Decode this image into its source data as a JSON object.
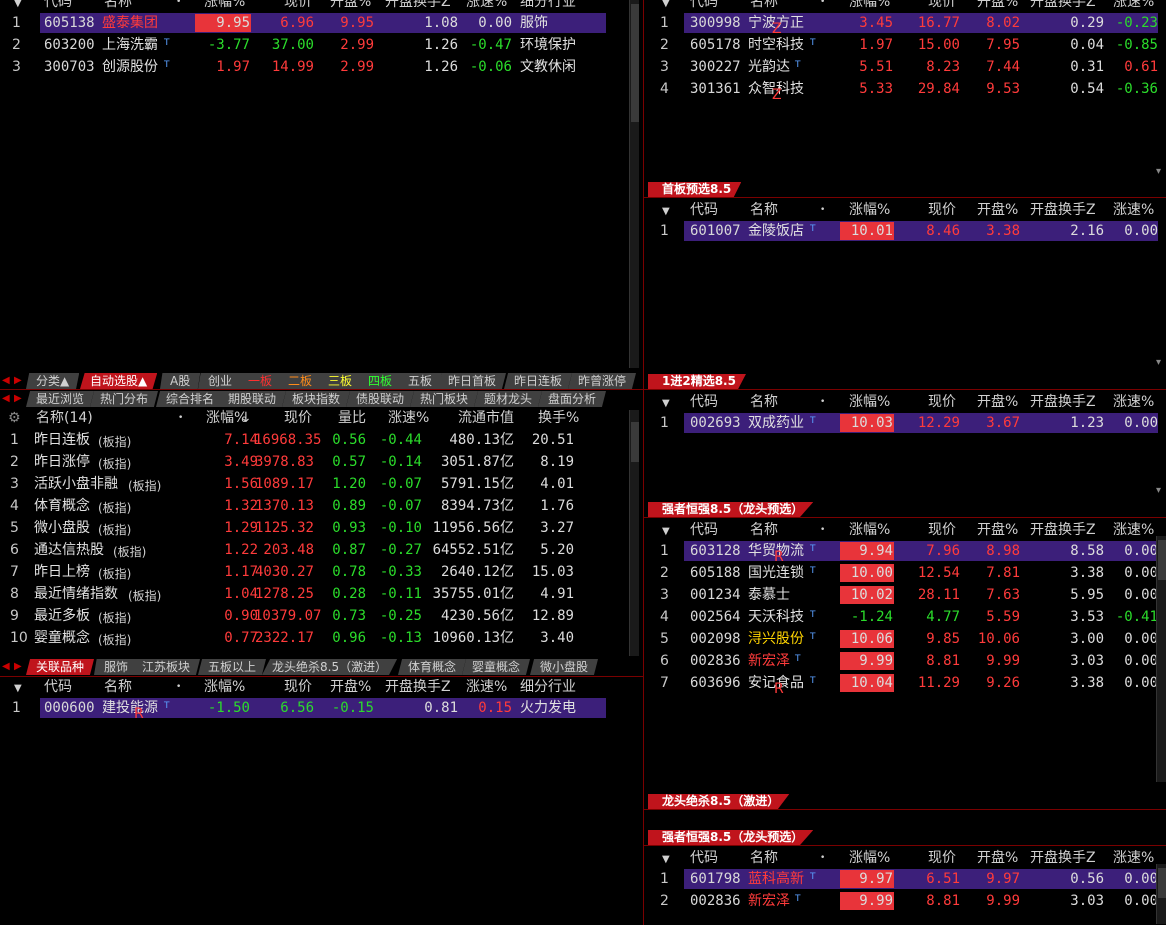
{
  "colors": {
    "up": "#ff3b3b",
    "down": "#2bdc2b",
    "selected": "#3c1f7a",
    "accent": "#c0141c"
  },
  "top_left": {
    "header": [
      "代码",
      "名称",
      "•",
      "涨幅%",
      "现价",
      "开盘%",
      "开盘换手Z",
      "涨速%",
      "细分行业"
    ],
    "rows": [
      {
        "idx": "1",
        "code": "605138",
        "name": "盛泰集团",
        "chg": "9.95",
        "price": "6.96",
        "open": "9.95",
        "turn": "1.08",
        "speed": "0.00",
        "industry": "服饰"
      },
      {
        "idx": "2",
        "code": "603200",
        "name": "上海洗霸",
        "chg": "-3.77",
        "price": "37.00",
        "open": "2.99",
        "turn": "1.26",
        "speed": "-0.47",
        "industry": "环境保护"
      },
      {
        "idx": "3",
        "code": "300703",
        "name": "创源股份",
        "chg": "1.97",
        "price": "14.99",
        "open": "2.99",
        "turn": "1.26",
        "speed": "-0.06",
        "industry": "文教休闲"
      }
    ]
  },
  "tabs1": [
    "分类▲",
    "自动选股▲",
    "A股",
    "创业",
    "一板",
    "二板",
    "三板",
    "四板",
    "五板",
    "昨日首板",
    "昨日连板",
    "昨曾涨停"
  ],
  "tabs2": [
    "最近浏览",
    "热门分布",
    "综合排名",
    "期股联动",
    "板块指数",
    "债股联动",
    "热门板块",
    "题材龙头",
    "盘面分析"
  ],
  "sector": {
    "header": [
      "名称(14)",
      "•",
      "涨幅%",
      "现价",
      "量比",
      "涨速%",
      "流通市值",
      "换手%"
    ],
    "suffix": "(板指)",
    "rows": [
      {
        "idx": "1",
        "name": "昨日连板",
        "chg": "7.14",
        "price": "16968.35",
        "vr": "0.56",
        "speed": "-0.44",
        "cap": "480.13亿",
        "turn": "20.51"
      },
      {
        "idx": "2",
        "name": "昨日涨停",
        "chg": "3.49",
        "price": "3978.83",
        "vr": "0.57",
        "speed": "-0.14",
        "cap": "3051.87亿",
        "turn": "8.19"
      },
      {
        "idx": "3",
        "name": "活跃小盘非融",
        "chg": "1.56",
        "price": "1089.17",
        "vr": "1.20",
        "speed": "-0.07",
        "cap": "5791.15亿",
        "turn": "4.01"
      },
      {
        "idx": "4",
        "name": "体育概念",
        "chg": "1.32",
        "price": "1370.13",
        "vr": "0.89",
        "speed": "-0.07",
        "cap": "8394.73亿",
        "turn": "1.76"
      },
      {
        "idx": "5",
        "name": "微小盘股",
        "chg": "1.29",
        "price": "1125.32",
        "vr": "0.93",
        "speed": "-0.10",
        "cap": "11956.56亿",
        "turn": "3.27"
      },
      {
        "idx": "6",
        "name": "通达信热股",
        "chg": "1.22",
        "price": "203.48",
        "vr": "0.87",
        "speed": "-0.27",
        "cap": "64552.51亿",
        "turn": "5.20"
      },
      {
        "idx": "7",
        "name": "昨日上榜",
        "chg": "1.17",
        "price": "4030.27",
        "vr": "0.78",
        "speed": "-0.33",
        "cap": "2640.12亿",
        "turn": "15.03"
      },
      {
        "idx": "8",
        "name": "最近情绪指数",
        "chg": "1.04",
        "price": "1278.25",
        "vr": "0.28",
        "speed": "-0.11",
        "cap": "35755.01亿",
        "turn": "4.91"
      },
      {
        "idx": "9",
        "name": "最近多板",
        "chg": "0.90",
        "price": "10379.07",
        "vr": "0.73",
        "speed": "-0.25",
        "cap": "4230.56亿",
        "turn": "12.89"
      },
      {
        "idx": "10",
        "name": "婴童概念",
        "chg": "0.77",
        "price": "2322.17",
        "vr": "0.96",
        "speed": "-0.13",
        "cap": "10960.13亿",
        "turn": "3.40"
      }
    ]
  },
  "tabs3": [
    "关联品种",
    "服饰",
    "江苏板块",
    "五板以上",
    "龙头绝杀8.5（激进）",
    "体育概念",
    "婴童概念",
    "微小盘股"
  ],
  "related": {
    "header": [
      "代码",
      "名称",
      "•",
      "涨幅%",
      "现价",
      "开盘%",
      "开盘换手Z",
      "涨速%",
      "细分行业"
    ],
    "rows": [
      {
        "idx": "1",
        "code": "000600",
        "name": "建投能源",
        "tag": "R",
        "chg": "-1.50",
        "price": "6.56",
        "open": "-0.15",
        "turn": "0.81",
        "speed": "0.15",
        "industry": "火力发电"
      }
    ]
  },
  "right_header": [
    "代码",
    "名称",
    "•",
    "涨幅%",
    "现价",
    "开盘%",
    "开盘换手Z",
    "涨速%"
  ],
  "r1": {
    "rows": [
      {
        "idx": "1",
        "code": "300998",
        "name": "宁波方正",
        "tag": "Z",
        "chg": "3.45",
        "price": "16.77",
        "open": "8.02",
        "turn": "0.29",
        "speed": "-0.23"
      },
      {
        "idx": "2",
        "code": "605178",
        "name": "时空科技",
        "tag": "",
        "chg": "1.97",
        "price": "15.00",
        "open": "7.95",
        "turn": "0.04",
        "speed": "-0.85"
      },
      {
        "idx": "3",
        "code": "300227",
        "name": "光韵达",
        "tag": "",
        "chg": "5.51",
        "price": "8.23",
        "open": "7.44",
        "turn": "0.31",
        "speed": "0.61"
      },
      {
        "idx": "4",
        "code": "301361",
        "name": "众智科技",
        "tag": "Z",
        "chg": "5.33",
        "price": "29.84",
        "open": "9.53",
        "turn": "0.54",
        "speed": "-0.36"
      }
    ]
  },
  "r2": {
    "title": "首板预选8.5",
    "rows": [
      {
        "idx": "1",
        "code": "601007",
        "name": "金陵饭店",
        "tag": "",
        "chg": "10.01",
        "price": "8.46",
        "open": "3.38",
        "turn": "2.16",
        "speed": "0.00"
      }
    ]
  },
  "r3": {
    "title": "1进2精选8.5",
    "rows": [
      {
        "idx": "1",
        "code": "002693",
        "name": "双成药业",
        "tag": "",
        "chg": "10.03",
        "price": "12.29",
        "open": "3.67",
        "turn": "1.23",
        "speed": "0.00"
      }
    ]
  },
  "r4": {
    "title": "强者恒强8.5（龙头预选）",
    "rows": [
      {
        "idx": "1",
        "code": "603128",
        "name": "华贸物流",
        "tag": "R",
        "chg": "9.94",
        "price": "7.96",
        "open": "8.98",
        "turn": "8.58",
        "speed": "0.00"
      },
      {
        "idx": "2",
        "code": "605188",
        "name": "国光连锁",
        "tag": "",
        "chg": "10.00",
        "price": "12.54",
        "open": "7.81",
        "turn": "3.38",
        "speed": "0.00"
      },
      {
        "idx": "3",
        "code": "001234",
        "name": "泰慕士",
        "tag": "",
        "chg": "10.02",
        "price": "28.11",
        "open": "7.63",
        "turn": "5.95",
        "speed": "0.00"
      },
      {
        "idx": "4",
        "code": "002564",
        "name": "天沃科技",
        "tag": "",
        "chg": "-1.24",
        "price": "4.77",
        "open": "5.59",
        "turn": "3.53",
        "speed": "-0.41"
      },
      {
        "idx": "5",
        "code": "002098",
        "name": "浔兴股份",
        "tag": "",
        "chg": "10.06",
        "price": "9.85",
        "open": "10.06",
        "turn": "3.00",
        "speed": "0.00"
      },
      {
        "idx": "6",
        "code": "002836",
        "name": "新宏泽",
        "tag": "",
        "chg": "9.99",
        "price": "8.81",
        "open": "9.99",
        "turn": "3.03",
        "speed": "0.00"
      },
      {
        "idx": "7",
        "code": "603696",
        "name": "安记食品",
        "tag": "R",
        "chg": "10.04",
        "price": "11.29",
        "open": "9.26",
        "turn": "3.38",
        "speed": "0.00"
      }
    ]
  },
  "r5": {
    "title": "龙头绝杀8.5（激进）"
  },
  "r6": {
    "title": "强者恒强8.5（龙头预选）",
    "rows": [
      {
        "idx": "1",
        "code": "601798",
        "name": "蓝科高新",
        "tag": "",
        "chg": "9.97",
        "price": "6.51",
        "open": "9.97",
        "turn": "0.56",
        "speed": "0.00"
      },
      {
        "idx": "2",
        "code": "002836",
        "name": "新宏泽",
        "tag": "",
        "chg": "9.99",
        "price": "8.81",
        "open": "9.99",
        "turn": "3.03",
        "speed": "0.00"
      }
    ]
  }
}
